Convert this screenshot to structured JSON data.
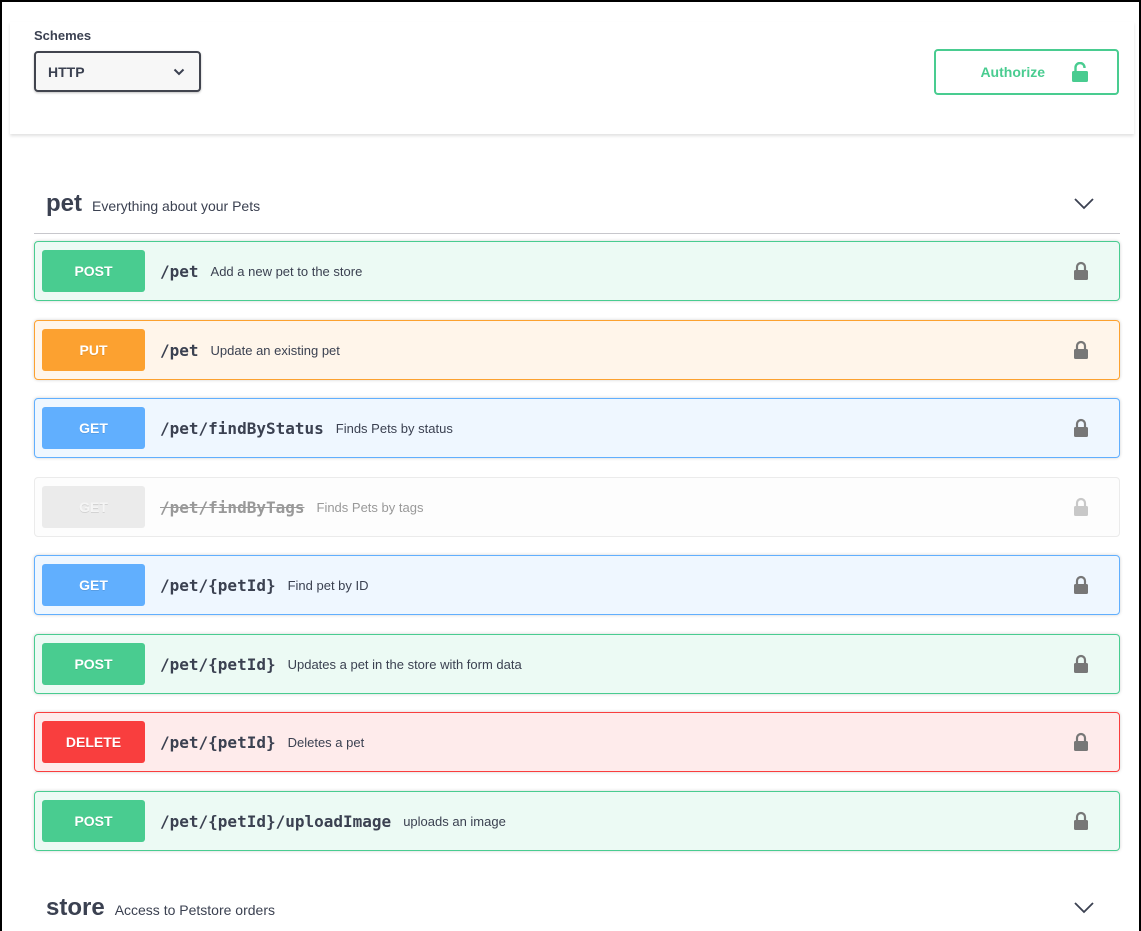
{
  "schemes": {
    "label": "Schemes",
    "selected": "HTTP"
  },
  "authorize": {
    "label": "Authorize"
  },
  "colors": {
    "post": "#49cc90",
    "put": "#fca130",
    "get": "#61affe",
    "delete": "#f93e3e",
    "deprecated": "#ebebeb"
  },
  "tags": [
    {
      "name": "pet",
      "description": "Everything about your Pets"
    },
    {
      "name": "store",
      "description": "Access to Petstore orders"
    }
  ],
  "operations": [
    {
      "method": "POST",
      "path": "/pet",
      "summary": "Add a new pet to the store",
      "icon": "lock-icon"
    },
    {
      "method": "PUT",
      "path": "/pet",
      "summary": "Update an existing pet",
      "icon": "lock-icon"
    },
    {
      "method": "GET",
      "path": "/pet/findByStatus",
      "summary": "Finds Pets by status",
      "icon": "lock-icon"
    },
    {
      "method": "GET",
      "path": "/pet/findByTags",
      "summary": "Finds Pets by tags",
      "deprecated": true,
      "icon": "lock-icon"
    },
    {
      "method": "GET",
      "path": "/pet/{petId}",
      "summary": "Find pet by ID",
      "icon": "lock-icon"
    },
    {
      "method": "POST",
      "path": "/pet/{petId}",
      "summary": "Updates a pet in the store with form data",
      "icon": "lock-icon"
    },
    {
      "method": "DELETE",
      "path": "/pet/{petId}",
      "summary": "Deletes a pet",
      "icon": "lock-icon"
    },
    {
      "method": "POST",
      "path": "/pet/{petId}/uploadImage",
      "summary": "uploads an image",
      "icon": "lock-icon"
    }
  ]
}
